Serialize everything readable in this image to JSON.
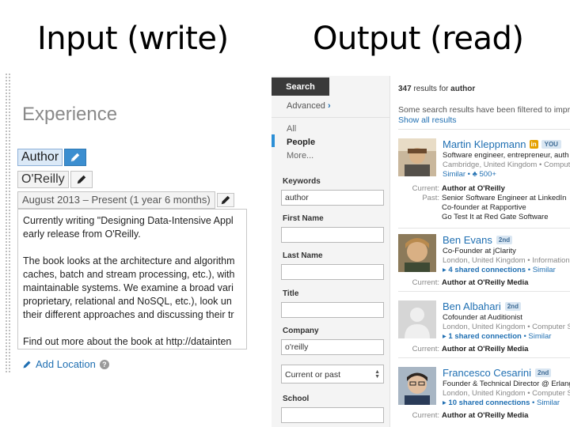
{
  "slide": {
    "title_left": "Input (write)",
    "title_right": "Output (read)"
  },
  "editor": {
    "heading": "Experience",
    "title_value": "Author",
    "company_value": "O'Reilly",
    "dates_value": "August 2013 – Present (1 year 6 months)",
    "description_lines": [
      "Currently writing \"Designing Data-Intensive Appl",
      "early release from O'Reilly.",
      "",
      "The book looks at the architecture and algorithm",
      "caches, batch and stream processing, etc.), with",
      "maintainable systems. We examine a broad vari",
      "proprietary, relational and NoSQL, etc.), look un",
      "their different approaches and discussing their tr",
      "",
      "Find out more about the book at http://datainten"
    ],
    "add_location_label": "Add Location",
    "help_glyph": "?"
  },
  "search": {
    "search_button": "Search",
    "advanced_label": "Advanced",
    "advanced_chevron": "›",
    "facets": [
      "All",
      "People",
      "More..."
    ],
    "active_facet": "People",
    "fields": {
      "keywords": {
        "label": "Keywords",
        "value": "author"
      },
      "first_name": {
        "label": "First Name",
        "value": ""
      },
      "last_name": {
        "label": "Last Name",
        "value": ""
      },
      "title": {
        "label": "Title",
        "value": ""
      },
      "company": {
        "label": "Company",
        "value": "o'reilly"
      },
      "current_or_past": {
        "value": "Current or past"
      },
      "school": {
        "label": "School",
        "value": ""
      }
    },
    "results_count": "347",
    "results_for_label": "results for",
    "results_query": "author",
    "filter_note": "Some search results have been filtered to impro",
    "show_all_label": "Show all results",
    "results": [
      {
        "name": "Martin Kleppmann",
        "badge_in": "in",
        "badge_you": "YOU",
        "headline": "Software engineer, entrepreneur, auth",
        "meta": "Cambridge, United Kingdom • Compute",
        "similar": "Similar • ♣ 500+",
        "current_label": "Current:",
        "current_value_bold": "Author at O'Reilly",
        "past_label": "Past:",
        "past_values": [
          "Senior Software Engineer at LinkedIn",
          "Co-founder at Rapportive",
          "Go Test It at Red Gate Software"
        ]
      },
      {
        "name": "Ben Evans",
        "degree": "2nd",
        "headline": "Co-Founder at jClarity",
        "meta": "London, United Kingdom • Information",
        "shared": "4 shared connections",
        "similar": "Similar",
        "current_label": "Current:",
        "current_value_bold": "Author at O'Reilly Media"
      },
      {
        "name": "Ben Albahari",
        "degree": "2nd",
        "headline": "Cofounder at Auditionist",
        "meta": "London, United Kingdom • Computer S",
        "shared": "1 shared connection",
        "similar": "Similar",
        "current_label": "Current:",
        "current_value_bold": "Author at O'Reilly Media"
      },
      {
        "name": "Francesco Cesarini",
        "degree": "2nd",
        "headline": "Founder & Technical Director @ Erlang",
        "meta": "London, United Kingdom • Computer S",
        "shared": "10 shared connections",
        "similar": "Similar",
        "current_label": "Current:",
        "current_value_bold": "Author at O'Reilly Media"
      }
    ]
  },
  "colors": {
    "link_blue": "#1f6fb2",
    "edit_active_blue": "#3b8ed0",
    "highlight_field": "#dbe9f7",
    "search_button_dark": "#3a3a3a",
    "facet_active_bar": "#2c8fd6"
  }
}
